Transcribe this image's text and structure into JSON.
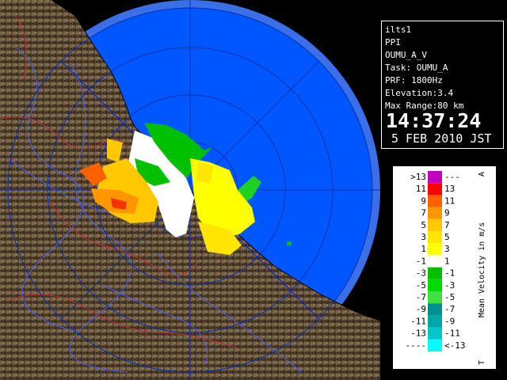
{
  "info": {
    "lines": [
      "ilts1",
      "PPI",
      "OUMU_A_V",
      "Task: OUMU_A",
      "PRF: 1800Hz",
      "Elevation:3.4",
      "Max Range:80 km"
    ],
    "time": "14:37:24",
    "date": "5 FEB 2010 JST"
  },
  "legend": {
    "title": "Mean Velocity in m/s",
    "corner_top": "A",
    "corner_bottom": "T",
    "left_labels": [
      ">13",
      "11",
      "9",
      "7",
      "5",
      "3",
      "1",
      "-1",
      "-3",
      "-5",
      "-7",
      "-9",
      "-11",
      "-13",
      "----"
    ],
    "right_labels": [
      "---",
      "13",
      "11",
      "9",
      "7",
      "5",
      "3",
      "1",
      "-1",
      "-3",
      "-5",
      "-7",
      "-9",
      "-11",
      "<-13"
    ],
    "colors": [
      "#c000c0",
      "#ff0000",
      "#ff6000",
      "#ff9600",
      "#ffc800",
      "#ffe600",
      "#ffff00",
      "#ffffff",
      "#00c000",
      "#00dc00",
      "#40e040",
      "#009090",
      "#00a8a8",
      "#00c8c8",
      "#00ffff"
    ]
  },
  "map": {
    "ocean_color": "#0055ff",
    "range_ring_color": "#004cd0",
    "land_color": "#5a4a38"
  }
}
